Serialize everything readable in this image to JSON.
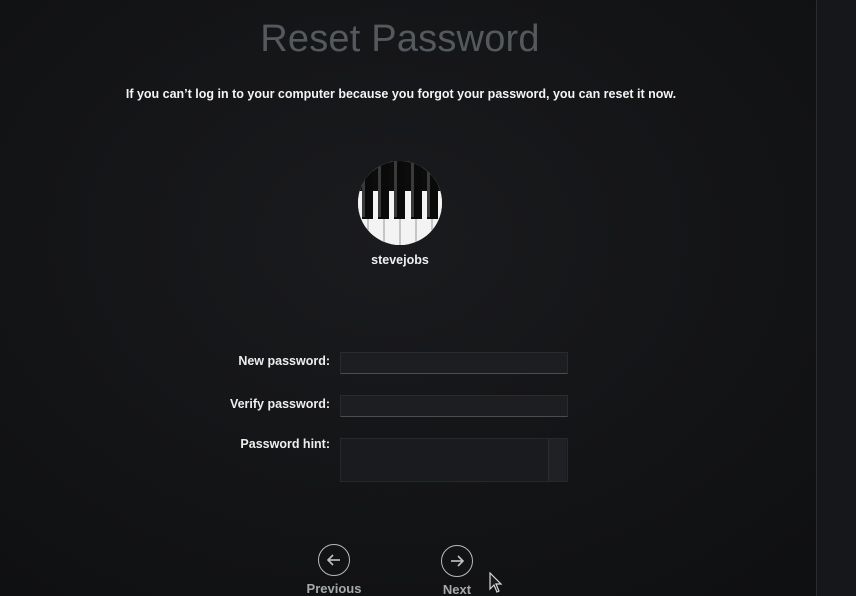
{
  "header": {
    "title": "Reset Password",
    "subtitle": "If you can’t log in to your computer because you forgot your password, you can reset it now."
  },
  "user": {
    "username": "stevejobs",
    "avatar_icon": "piano-keys-icon"
  },
  "form": {
    "new_password_label": "New password:",
    "new_password_value": "",
    "verify_password_label": "Verify password:",
    "verify_password_value": "",
    "hint_label": "Password hint:",
    "hint_value": ""
  },
  "navigation": {
    "previous_label": "Previous",
    "previous_icon": "arrow-left-circle-icon",
    "next_label": "Next",
    "next_icon": "arrow-right-circle-icon"
  },
  "colors": {
    "background": "#121315",
    "title_text": "#55585c",
    "body_text": "#ffffff",
    "nav_text": "#a7a9ac"
  }
}
